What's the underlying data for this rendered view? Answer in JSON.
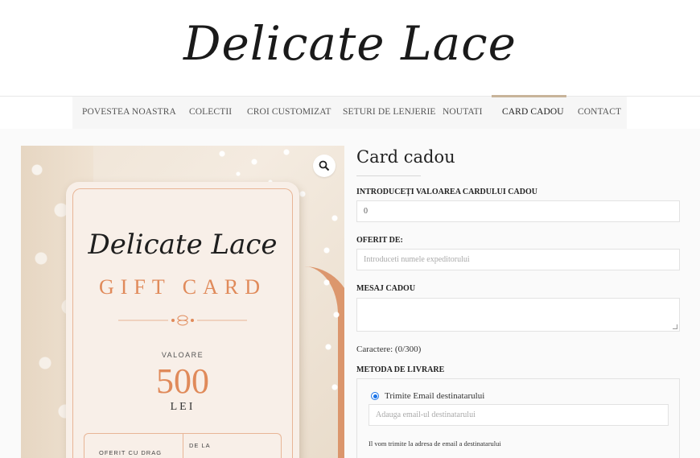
{
  "brand": {
    "logo_text": "Delicate Lace"
  },
  "nav": {
    "items": [
      {
        "label": "POVESTEA NOASTRA",
        "active": false
      },
      {
        "label": "COLECTII",
        "active": false
      },
      {
        "label": "CROI CUSTOMIZAT",
        "active": false
      },
      {
        "label": "SETURI DE LENJERIE",
        "active": false
      },
      {
        "label": "NOUTATI",
        "active": false
      },
      {
        "label": "CARD CADOU",
        "active": true
      },
      {
        "label": "CONTACT",
        "active": false
      }
    ],
    "active_color": "#c8b49a"
  },
  "product_image": {
    "card_logo": "Delicate Lace",
    "card_title": "GIFT CARD",
    "value_label": "VALOARE",
    "value": "500",
    "currency": "LEI",
    "from_label": "OFERIT CU DRAG",
    "dela_label": "DE LA",
    "accent_color": "#e08a5a",
    "zoom_icon": "zoom-icon"
  },
  "form": {
    "title": "Card cadou",
    "amount_label": "INTRODUCEȚI VALOAREA CARDULUI CADOU",
    "amount_value": "0",
    "from_label": "OFERIT DE:",
    "from_placeholder": "Introduceti numele expeditorului",
    "message_label": "MESAJ CADOU",
    "char_count": "Caractere: (0/300)",
    "delivery_label": "METODA DE LIVRARE",
    "delivery_option": "Trimite Email destinatarului",
    "email_placeholder": "Adauga email-ul destinatarului",
    "email_note": "Il vom trimite la adresa de email a destinatarului",
    "radio_color": "#1a73e8"
  }
}
